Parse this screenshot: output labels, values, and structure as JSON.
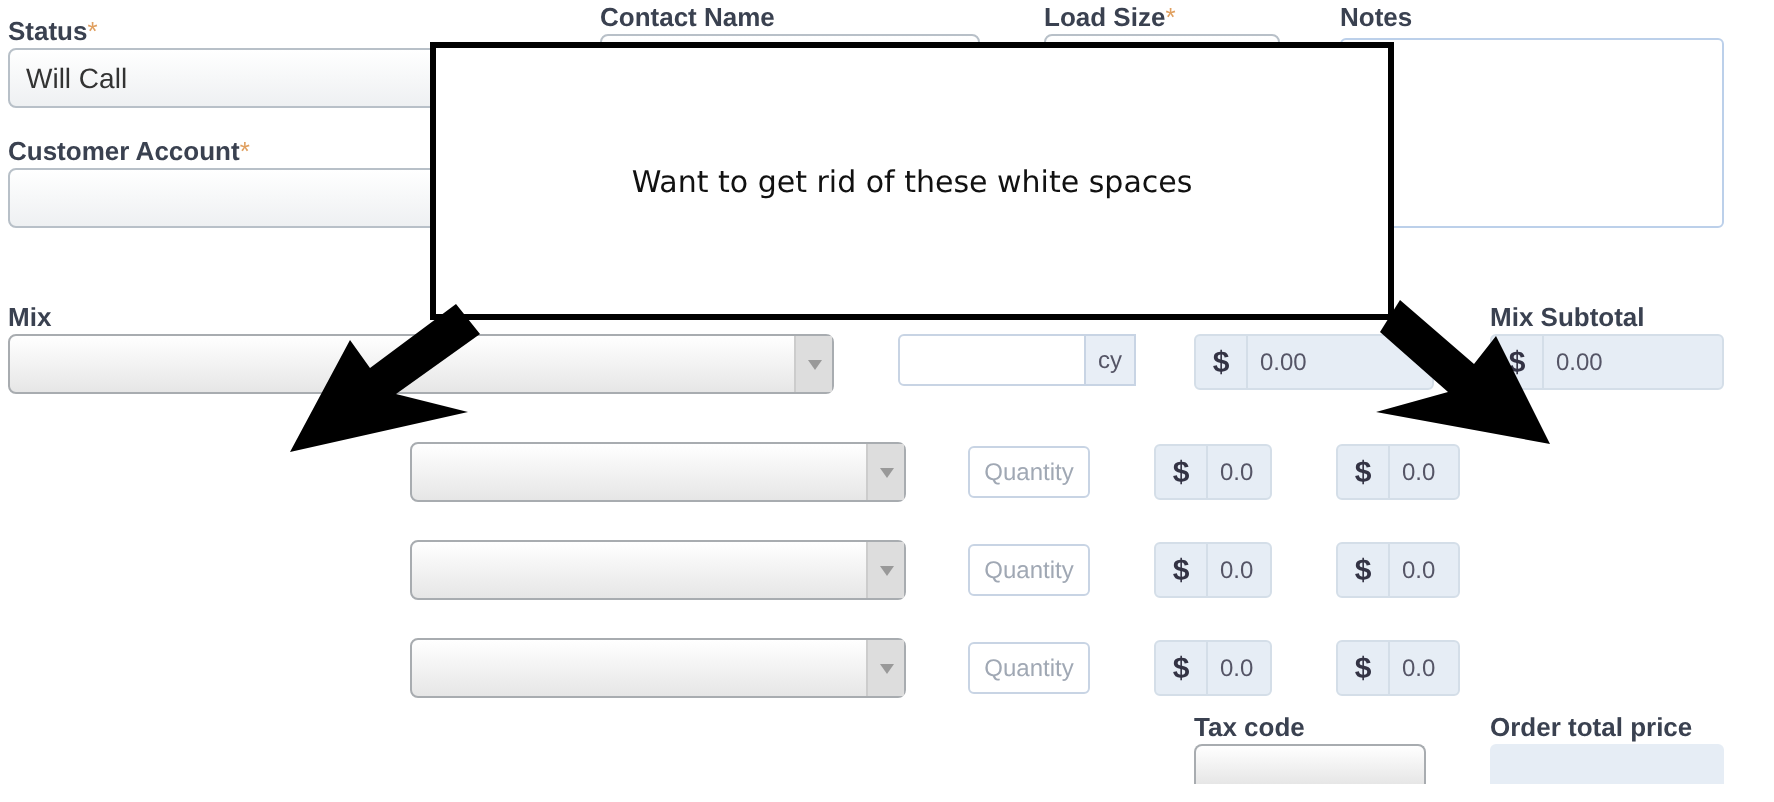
{
  "fields": {
    "status": {
      "label": "Status",
      "mark": "*",
      "value": "Will Call"
    },
    "contact_name": {
      "label": "Contact Name"
    },
    "load_size": {
      "label": "Load Size",
      "mark": "*"
    },
    "notes": {
      "label": "Notes"
    },
    "customer_account": {
      "label": "Customer Account",
      "mark": "*"
    }
  },
  "mix": {
    "label": "Mix",
    "unit": "cy",
    "price_symbol": "$",
    "price": "0.00",
    "subtotal_label": "Mix Subtotal",
    "subtotal_symbol": "$",
    "subtotal": "0.00"
  },
  "extra_rows": [
    {
      "placeholder": "Quantity",
      "price_symbol": "$",
      "price": "0.0",
      "subtotal_symbol": "$",
      "subtotal": "0.0"
    },
    {
      "placeholder": "Quantity",
      "price_symbol": "$",
      "price": "0.0",
      "subtotal_symbol": "$",
      "subtotal": "0.0"
    },
    {
      "placeholder": "Quantity",
      "price_symbol": "$",
      "price": "0.0",
      "subtotal_symbol": "$",
      "subtotal": "0.0"
    }
  ],
  "tax_code": {
    "label": "Tax code"
  },
  "order_total": {
    "label": "Order total price"
  },
  "callout": {
    "text": "Want to get rid of these white spaces"
  }
}
